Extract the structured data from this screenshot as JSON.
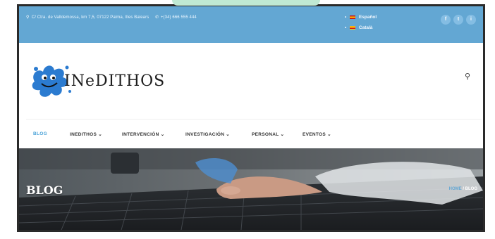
{
  "colors": {
    "accent": "#63a7d3",
    "topbar": "#63a7d3",
    "nav_active": "#4aa3d8",
    "frame": "#2a2a2a"
  },
  "topbar": {
    "address": "C/ Ctra. de Valldemossa, km 7,5, 07122 Palma, Illes Balears",
    "phone": "+(34) 666 555 444",
    "languages": [
      {
        "label": "Español",
        "flag": "es"
      },
      {
        "label": "Català",
        "flag": "ca"
      }
    ],
    "social": [
      {
        "icon": "facebook-icon",
        "glyph": "f"
      },
      {
        "icon": "twitter-icon",
        "glyph": "t"
      },
      {
        "icon": "instagram-icon",
        "glyph": "i"
      }
    ]
  },
  "header": {
    "brand": "INeDITHOS",
    "logo_icon": "blue-splash-smiley-logo",
    "search_icon": "search-icon"
  },
  "nav": {
    "items": [
      {
        "label": "BLOG",
        "active": true,
        "dropdown": false
      },
      {
        "label": "INEDITHOS",
        "active": false,
        "dropdown": true
      },
      {
        "label": "INTERVENCIÓN",
        "active": false,
        "dropdown": true
      },
      {
        "label": "INVESTIGACIÓN",
        "active": false,
        "dropdown": true
      },
      {
        "label": "PERSONAL",
        "active": false,
        "dropdown": true
      },
      {
        "label": "EVENTOS",
        "active": false,
        "dropdown": true
      }
    ],
    "dropdown_glyph": "⌄"
  },
  "hero": {
    "title": "BLOG",
    "breadcrumb_home": "HOME",
    "breadcrumb_sep": "/",
    "breadcrumb_current": "BLOG"
  }
}
